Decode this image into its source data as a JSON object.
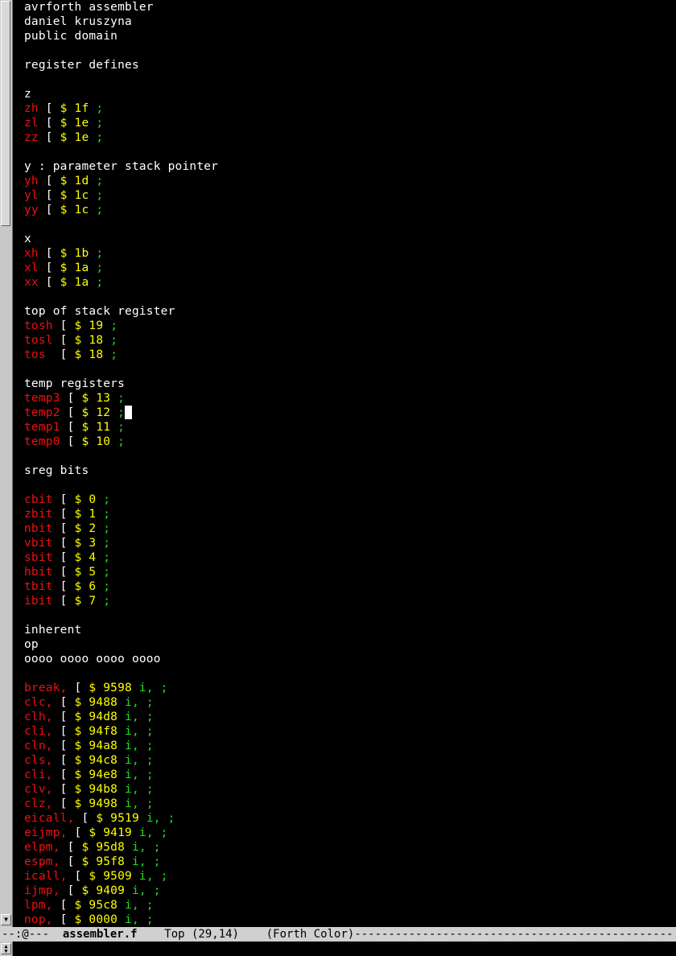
{
  "lines": [
    [
      {
        "t": "avrforth assembler",
        "c": "w"
      }
    ],
    [
      {
        "t": "daniel kruszyna",
        "c": "w"
      }
    ],
    [
      {
        "t": "public domain",
        "c": "w"
      }
    ],
    [],
    [
      {
        "t": "register defines",
        "c": "w"
      }
    ],
    [],
    [
      {
        "t": "z",
        "c": "w"
      }
    ],
    [
      {
        "t": "zh",
        "c": "r"
      },
      {
        "t": " [ ",
        "c": "w"
      },
      {
        "t": "$ 1f",
        "c": "y"
      },
      {
        "t": " ;",
        "c": "g"
      }
    ],
    [
      {
        "t": "zl",
        "c": "r"
      },
      {
        "t": " [ ",
        "c": "w"
      },
      {
        "t": "$ 1e",
        "c": "y"
      },
      {
        "t": " ;",
        "c": "g"
      }
    ],
    [
      {
        "t": "zz",
        "c": "r"
      },
      {
        "t": " [ ",
        "c": "w"
      },
      {
        "t": "$ 1e",
        "c": "y"
      },
      {
        "t": " ;",
        "c": "g"
      }
    ],
    [],
    [
      {
        "t": "y : parameter stack pointer",
        "c": "w"
      }
    ],
    [
      {
        "t": "yh",
        "c": "r"
      },
      {
        "t": " [ ",
        "c": "w"
      },
      {
        "t": "$ 1d",
        "c": "y"
      },
      {
        "t": " ;",
        "c": "g"
      }
    ],
    [
      {
        "t": "yl",
        "c": "r"
      },
      {
        "t": " [ ",
        "c": "w"
      },
      {
        "t": "$ 1c",
        "c": "y"
      },
      {
        "t": " ;",
        "c": "g"
      }
    ],
    [
      {
        "t": "yy",
        "c": "r"
      },
      {
        "t": " [ ",
        "c": "w"
      },
      {
        "t": "$ 1c",
        "c": "y"
      },
      {
        "t": " ;",
        "c": "g"
      }
    ],
    [],
    [
      {
        "t": "x",
        "c": "w"
      }
    ],
    [
      {
        "t": "xh",
        "c": "r"
      },
      {
        "t": " [ ",
        "c": "w"
      },
      {
        "t": "$ 1b",
        "c": "y"
      },
      {
        "t": " ;",
        "c": "g"
      }
    ],
    [
      {
        "t": "xl",
        "c": "r"
      },
      {
        "t": " [ ",
        "c": "w"
      },
      {
        "t": "$ 1a",
        "c": "y"
      },
      {
        "t": " ;",
        "c": "g"
      }
    ],
    [
      {
        "t": "xx",
        "c": "r"
      },
      {
        "t": " [ ",
        "c": "w"
      },
      {
        "t": "$ 1a",
        "c": "y"
      },
      {
        "t": " ;",
        "c": "g"
      }
    ],
    [],
    [
      {
        "t": "top of stack register",
        "c": "w"
      }
    ],
    [
      {
        "t": "tosh",
        "c": "r"
      },
      {
        "t": " [ ",
        "c": "w"
      },
      {
        "t": "$ 19",
        "c": "y"
      },
      {
        "t": " ;",
        "c": "g"
      }
    ],
    [
      {
        "t": "tosl",
        "c": "r"
      },
      {
        "t": " [ ",
        "c": "w"
      },
      {
        "t": "$ 18",
        "c": "y"
      },
      {
        "t": " ;",
        "c": "g"
      }
    ],
    [
      {
        "t": "tos",
        "c": "r"
      },
      {
        "t": "  [ ",
        "c": "w"
      },
      {
        "t": "$ 18",
        "c": "y"
      },
      {
        "t": " ;",
        "c": "g"
      }
    ],
    [],
    [
      {
        "t": "temp registers",
        "c": "w"
      }
    ],
    [
      {
        "t": "temp3",
        "c": "r"
      },
      {
        "t": " [ ",
        "c": "w"
      },
      {
        "t": "$ 13",
        "c": "y"
      },
      {
        "t": " ;",
        "c": "g"
      }
    ],
    [
      {
        "t": "temp2",
        "c": "r"
      },
      {
        "t": " [ ",
        "c": "w"
      },
      {
        "t": "$ 12",
        "c": "y"
      },
      {
        "t": " ;",
        "c": "g"
      },
      {
        "cursor": true
      }
    ],
    [
      {
        "t": "temp1",
        "c": "r"
      },
      {
        "t": " [ ",
        "c": "w"
      },
      {
        "t": "$ 11",
        "c": "y"
      },
      {
        "t": " ;",
        "c": "g"
      }
    ],
    [
      {
        "t": "temp0",
        "c": "r"
      },
      {
        "t": " [ ",
        "c": "w"
      },
      {
        "t": "$ 10",
        "c": "y"
      },
      {
        "t": " ;",
        "c": "g"
      }
    ],
    [],
    [
      {
        "t": "sreg bits",
        "c": "w"
      }
    ],
    [],
    [
      {
        "t": "cbit",
        "c": "r"
      },
      {
        "t": " [ ",
        "c": "w"
      },
      {
        "t": "$ 0",
        "c": "y"
      },
      {
        "t": " ;",
        "c": "g"
      }
    ],
    [
      {
        "t": "zbit",
        "c": "r"
      },
      {
        "t": " [ ",
        "c": "w"
      },
      {
        "t": "$ 1",
        "c": "y"
      },
      {
        "t": " ;",
        "c": "g"
      }
    ],
    [
      {
        "t": "nbit",
        "c": "r"
      },
      {
        "t": " [ ",
        "c": "w"
      },
      {
        "t": "$ 2",
        "c": "y"
      },
      {
        "t": " ;",
        "c": "g"
      }
    ],
    [
      {
        "t": "vbit",
        "c": "r"
      },
      {
        "t": " [ ",
        "c": "w"
      },
      {
        "t": "$ 3",
        "c": "y"
      },
      {
        "t": " ;",
        "c": "g"
      }
    ],
    [
      {
        "t": "sbit",
        "c": "r"
      },
      {
        "t": " [ ",
        "c": "w"
      },
      {
        "t": "$ 4",
        "c": "y"
      },
      {
        "t": " ;",
        "c": "g"
      }
    ],
    [
      {
        "t": "hbit",
        "c": "r"
      },
      {
        "t": " [ ",
        "c": "w"
      },
      {
        "t": "$ 5",
        "c": "y"
      },
      {
        "t": " ;",
        "c": "g"
      }
    ],
    [
      {
        "t": "tbit",
        "c": "r"
      },
      {
        "t": " [ ",
        "c": "w"
      },
      {
        "t": "$ 6",
        "c": "y"
      },
      {
        "t": " ;",
        "c": "g"
      }
    ],
    [
      {
        "t": "ibit",
        "c": "r"
      },
      {
        "t": " [ ",
        "c": "w"
      },
      {
        "t": "$ 7",
        "c": "y"
      },
      {
        "t": " ;",
        "c": "g"
      }
    ],
    [],
    [
      {
        "t": "inherent",
        "c": "w"
      }
    ],
    [
      {
        "t": "op",
        "c": "w"
      }
    ],
    [
      {
        "t": "oooo oooo oooo oooo",
        "c": "w"
      }
    ],
    [],
    [
      {
        "t": "break,",
        "c": "r"
      },
      {
        "t": " [ ",
        "c": "w"
      },
      {
        "t": "$ 9598",
        "c": "y"
      },
      {
        "t": " i,",
        "c": "g"
      },
      {
        "t": " ;",
        "c": "g"
      }
    ],
    [
      {
        "t": "clc,",
        "c": "r"
      },
      {
        "t": " [ ",
        "c": "w"
      },
      {
        "t": "$ 9488",
        "c": "y"
      },
      {
        "t": " i,",
        "c": "g"
      },
      {
        "t": " ;",
        "c": "g"
      }
    ],
    [
      {
        "t": "clh,",
        "c": "r"
      },
      {
        "t": " [ ",
        "c": "w"
      },
      {
        "t": "$ 94d8",
        "c": "y"
      },
      {
        "t": " i,",
        "c": "g"
      },
      {
        "t": " ;",
        "c": "g"
      }
    ],
    [
      {
        "t": "cli,",
        "c": "r"
      },
      {
        "t": " [ ",
        "c": "w"
      },
      {
        "t": "$ 94f8",
        "c": "y"
      },
      {
        "t": " i,",
        "c": "g"
      },
      {
        "t": " ;",
        "c": "g"
      }
    ],
    [
      {
        "t": "cln,",
        "c": "r"
      },
      {
        "t": " [ ",
        "c": "w"
      },
      {
        "t": "$ 94a8",
        "c": "y"
      },
      {
        "t": " i,",
        "c": "g"
      },
      {
        "t": " ;",
        "c": "g"
      }
    ],
    [
      {
        "t": "cls,",
        "c": "r"
      },
      {
        "t": " [ ",
        "c": "w"
      },
      {
        "t": "$ 94c8",
        "c": "y"
      },
      {
        "t": " i,",
        "c": "g"
      },
      {
        "t": " ;",
        "c": "g"
      }
    ],
    [
      {
        "t": "cli,",
        "c": "r"
      },
      {
        "t": " [ ",
        "c": "w"
      },
      {
        "t": "$ 94e8",
        "c": "y"
      },
      {
        "t": " i,",
        "c": "g"
      },
      {
        "t": " ;",
        "c": "g"
      }
    ],
    [
      {
        "t": "clv,",
        "c": "r"
      },
      {
        "t": " [ ",
        "c": "w"
      },
      {
        "t": "$ 94b8",
        "c": "y"
      },
      {
        "t": " i,",
        "c": "g"
      },
      {
        "t": " ;",
        "c": "g"
      }
    ],
    [
      {
        "t": "clz,",
        "c": "r"
      },
      {
        "t": " [ ",
        "c": "w"
      },
      {
        "t": "$ 9498",
        "c": "y"
      },
      {
        "t": " i,",
        "c": "g"
      },
      {
        "t": " ;",
        "c": "g"
      }
    ],
    [
      {
        "t": "eicall,",
        "c": "r"
      },
      {
        "t": " [ ",
        "c": "w"
      },
      {
        "t": "$ 9519",
        "c": "y"
      },
      {
        "t": " i,",
        "c": "g"
      },
      {
        "t": " ;",
        "c": "g"
      }
    ],
    [
      {
        "t": "eijmp,",
        "c": "r"
      },
      {
        "t": " [ ",
        "c": "w"
      },
      {
        "t": "$ 9419",
        "c": "y"
      },
      {
        "t": " i,",
        "c": "g"
      },
      {
        "t": " ;",
        "c": "g"
      }
    ],
    [
      {
        "t": "elpm,",
        "c": "r"
      },
      {
        "t": " [ ",
        "c": "w"
      },
      {
        "t": "$ 95d8",
        "c": "y"
      },
      {
        "t": " i,",
        "c": "g"
      },
      {
        "t": " ;",
        "c": "g"
      }
    ],
    [
      {
        "t": "espm,",
        "c": "r"
      },
      {
        "t": " [ ",
        "c": "w"
      },
      {
        "t": "$ 95f8",
        "c": "y"
      },
      {
        "t": " i,",
        "c": "g"
      },
      {
        "t": " ;",
        "c": "g"
      }
    ],
    [
      {
        "t": "icall,",
        "c": "r"
      },
      {
        "t": " [ ",
        "c": "w"
      },
      {
        "t": "$ 9509",
        "c": "y"
      },
      {
        "t": " i,",
        "c": "g"
      },
      {
        "t": " ;",
        "c": "g"
      }
    ],
    [
      {
        "t": "ijmp,",
        "c": "r"
      },
      {
        "t": " [ ",
        "c": "w"
      },
      {
        "t": "$ 9409",
        "c": "y"
      },
      {
        "t": " i,",
        "c": "g"
      },
      {
        "t": " ;",
        "c": "g"
      }
    ],
    [
      {
        "t": "lpm,",
        "c": "r"
      },
      {
        "t": " [ ",
        "c": "w"
      },
      {
        "t": "$ 95c8",
        "c": "y"
      },
      {
        "t": " i,",
        "c": "g"
      },
      {
        "t": " ;",
        "c": "g"
      }
    ],
    [
      {
        "t": "nop,",
        "c": "r"
      },
      {
        "t": " [ ",
        "c": "w"
      },
      {
        "t": "$ 0000",
        "c": "y"
      },
      {
        "t": " i,",
        "c": "g"
      },
      {
        "t": " ;",
        "c": "g"
      }
    ]
  ],
  "modeline": {
    "prefix": "--:@---  ",
    "buffer_name": "assembler.f",
    "position": "    Top (29,14)",
    "mode": "    (Forth Color)",
    "fill": "-----------------------------------------------"
  },
  "colors": {
    "background": "#000000",
    "default_text": "#ffffff",
    "word_definition": "#ee1010",
    "literal": "#ffff00",
    "compile_word": "#22dd22",
    "modeline_bg": "#d0d0d0"
  },
  "icons": {
    "scroll_down": "triangle-down-icon",
    "scroll_updown": "up-down-arrows-icon"
  }
}
